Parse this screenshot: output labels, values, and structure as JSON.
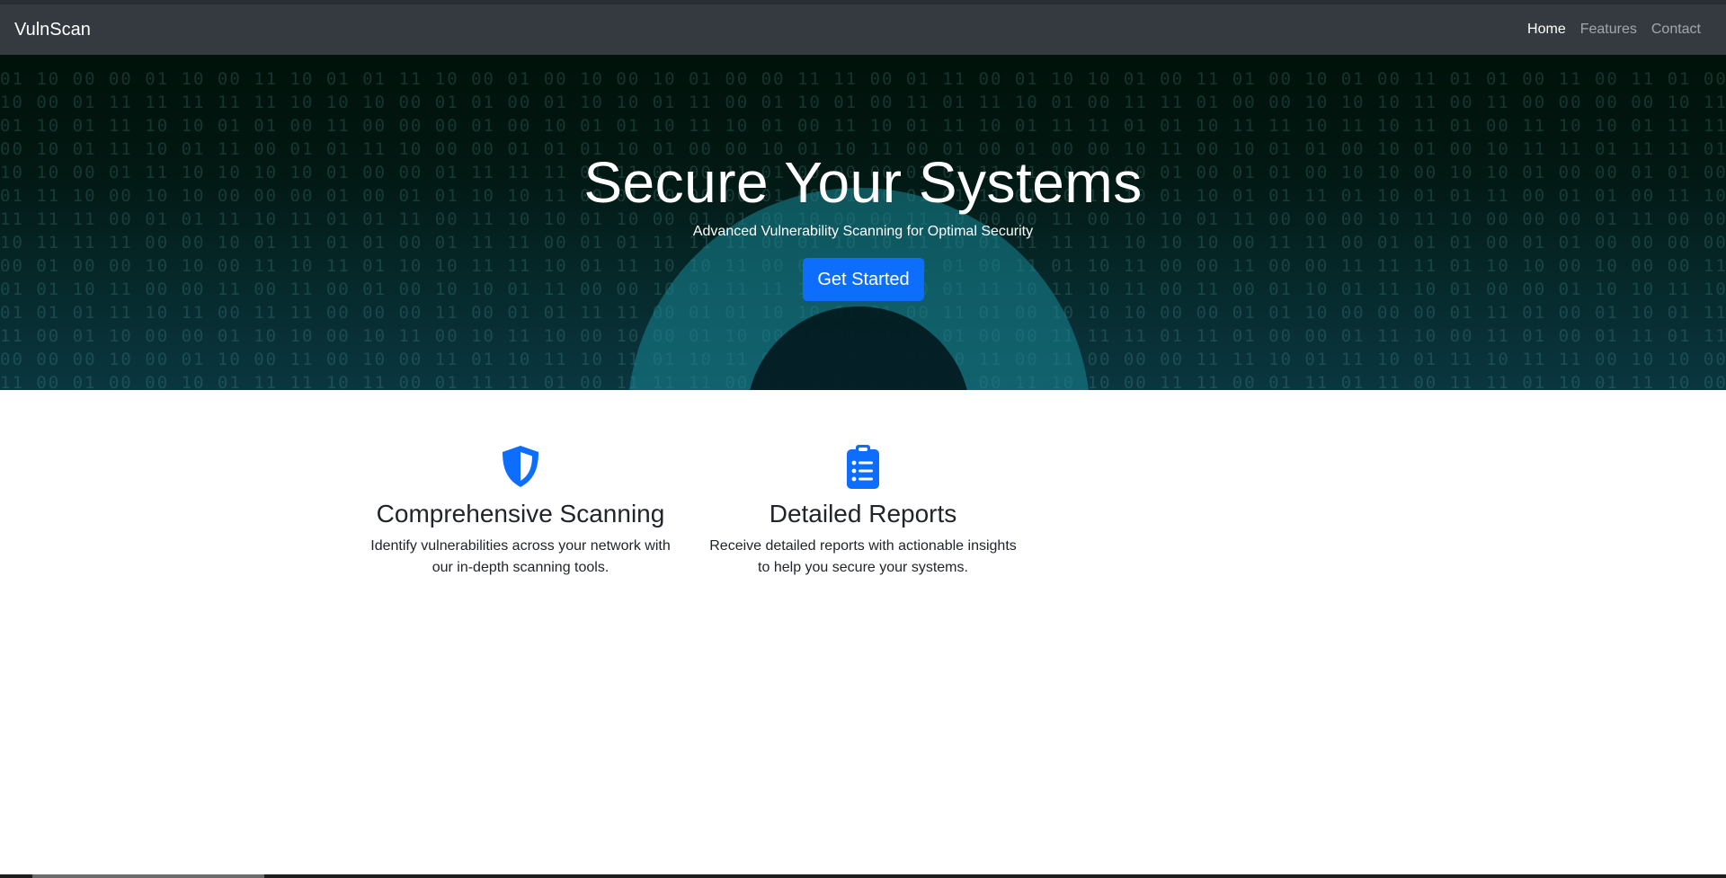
{
  "navbar": {
    "brand": "VulnScan",
    "links": [
      {
        "label": "Home",
        "active": true
      },
      {
        "label": "Features",
        "active": false
      },
      {
        "label": "Contact",
        "active": false
      }
    ]
  },
  "hero": {
    "title": "Secure Your Systems",
    "subtitle": "Advanced Vulnerability Scanning for Optimal Security",
    "cta_label": "Get Started",
    "background_icon": "binary-digits-lock-icon"
  },
  "features": [
    {
      "icon": "shield-icon",
      "title": "Comprehensive Scanning",
      "description": "Identify vulnerabilities across your network with our in-depth scanning tools."
    },
    {
      "icon": "clipboard-list-icon",
      "title": "Detailed Reports",
      "description": "Receive detailed reports with actionable insights to help you secure your systems."
    }
  ],
  "colors": {
    "navbar_bg": "#343a40",
    "accent": "#0d6efd",
    "hero_bg": "#021812",
    "text": "#212529"
  }
}
